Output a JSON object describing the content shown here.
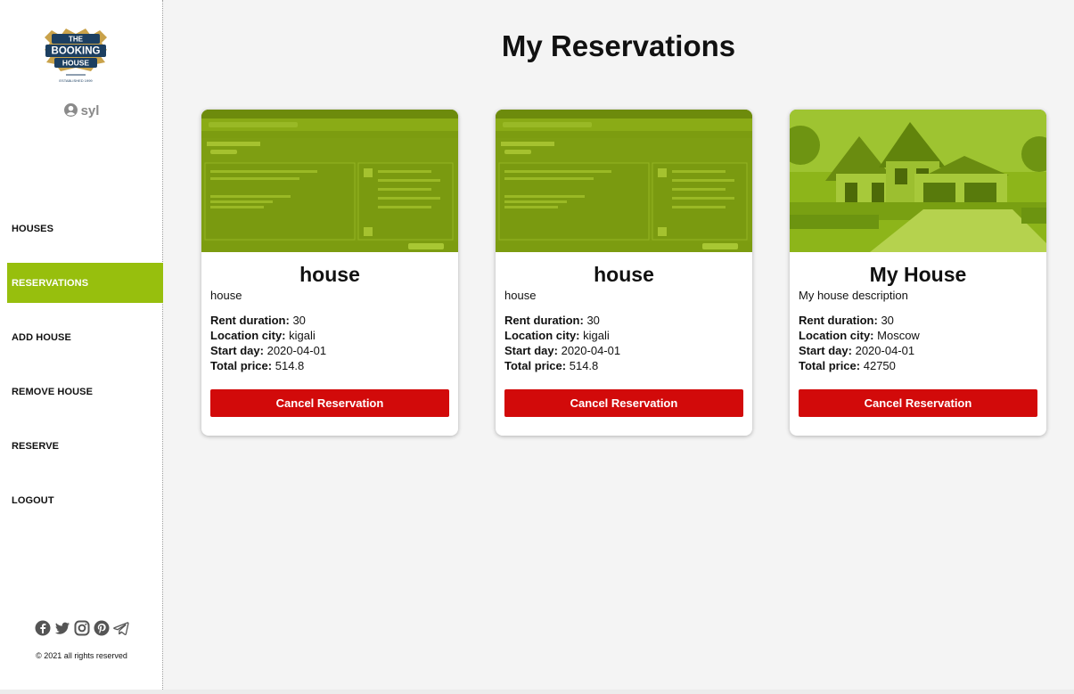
{
  "sidebar": {
    "logo": {
      "line1": "THE",
      "line2": "BOOKING",
      "line3": "HOUSE",
      "tagline": "ESTABLISHED 1999"
    },
    "user": {
      "name": "syl"
    },
    "nav": [
      {
        "label": "HOUSES",
        "active": false
      },
      {
        "label": "RESERVATIONS",
        "active": true
      },
      {
        "label": "ADD HOUSE",
        "active": false
      },
      {
        "label": "REMOVE HOUSE",
        "active": false
      },
      {
        "label": "RESERVE",
        "active": false
      },
      {
        "label": "LOGOUT",
        "active": false
      }
    ],
    "socials": [
      "facebook-icon",
      "twitter-icon",
      "instagram-icon",
      "pinterest-icon",
      "telegram-icon"
    ],
    "copyright": "© 2021 all rights reserved"
  },
  "main": {
    "title": "My Reservations",
    "labels": {
      "rent_duration": "Rent duration:",
      "location_city": "Location city:",
      "start_day": "Start day:",
      "total_price": "Total price:"
    },
    "cancel_label": "Cancel Reservation",
    "reservations": [
      {
        "title": "house",
        "description": "house",
        "rent_duration": "30",
        "location_city": "kigali",
        "start_day": "2020-04-01",
        "total_price": "514.8",
        "image": "screenshot"
      },
      {
        "title": "house",
        "description": "house",
        "rent_duration": "30",
        "location_city": "kigali",
        "start_day": "2020-04-01",
        "total_price": "514.8",
        "image": "screenshot"
      },
      {
        "title": "My House",
        "description": "My house description",
        "rent_duration": "30",
        "location_city": "Moscow",
        "start_day": "2020-04-01",
        "total_price": "42750",
        "image": "house-photo"
      }
    ]
  },
  "colors": {
    "accent": "#97bf0d",
    "cancel": "#d20a0a",
    "background": "#f4f4f4",
    "image_tint": "#8fb514"
  }
}
